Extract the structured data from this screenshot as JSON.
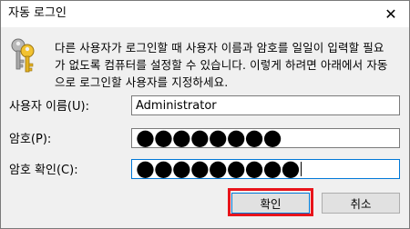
{
  "window": {
    "title": "자동 로그인",
    "close_glyph": "✕"
  },
  "description": {
    "lines": [
      "다른 사용자가 로그인할 때 사용자 이름과 암호를 일일이 입력할 필요",
      "가 없도록 컴퓨터를 설정할 수 있습니다. 이렇게 하려면 아래에서 자동",
      "으로 로그인할 사용자를 지정하세요."
    ]
  },
  "form": {
    "username_label": "사용자 이름(U):",
    "username_value": "Administrator",
    "password_label": "암호(P):",
    "password_value": "●●●●●●●●",
    "confirm_label": "암호 확인(C):",
    "confirm_value": "●●●●●●●●●"
  },
  "buttons": {
    "ok_label": "확인",
    "cancel_label": "취소"
  },
  "colors": {
    "highlight": "#e8141b",
    "accent": "#0078d7"
  },
  "icons": {
    "main": "keys-icon",
    "close": "close-icon"
  }
}
